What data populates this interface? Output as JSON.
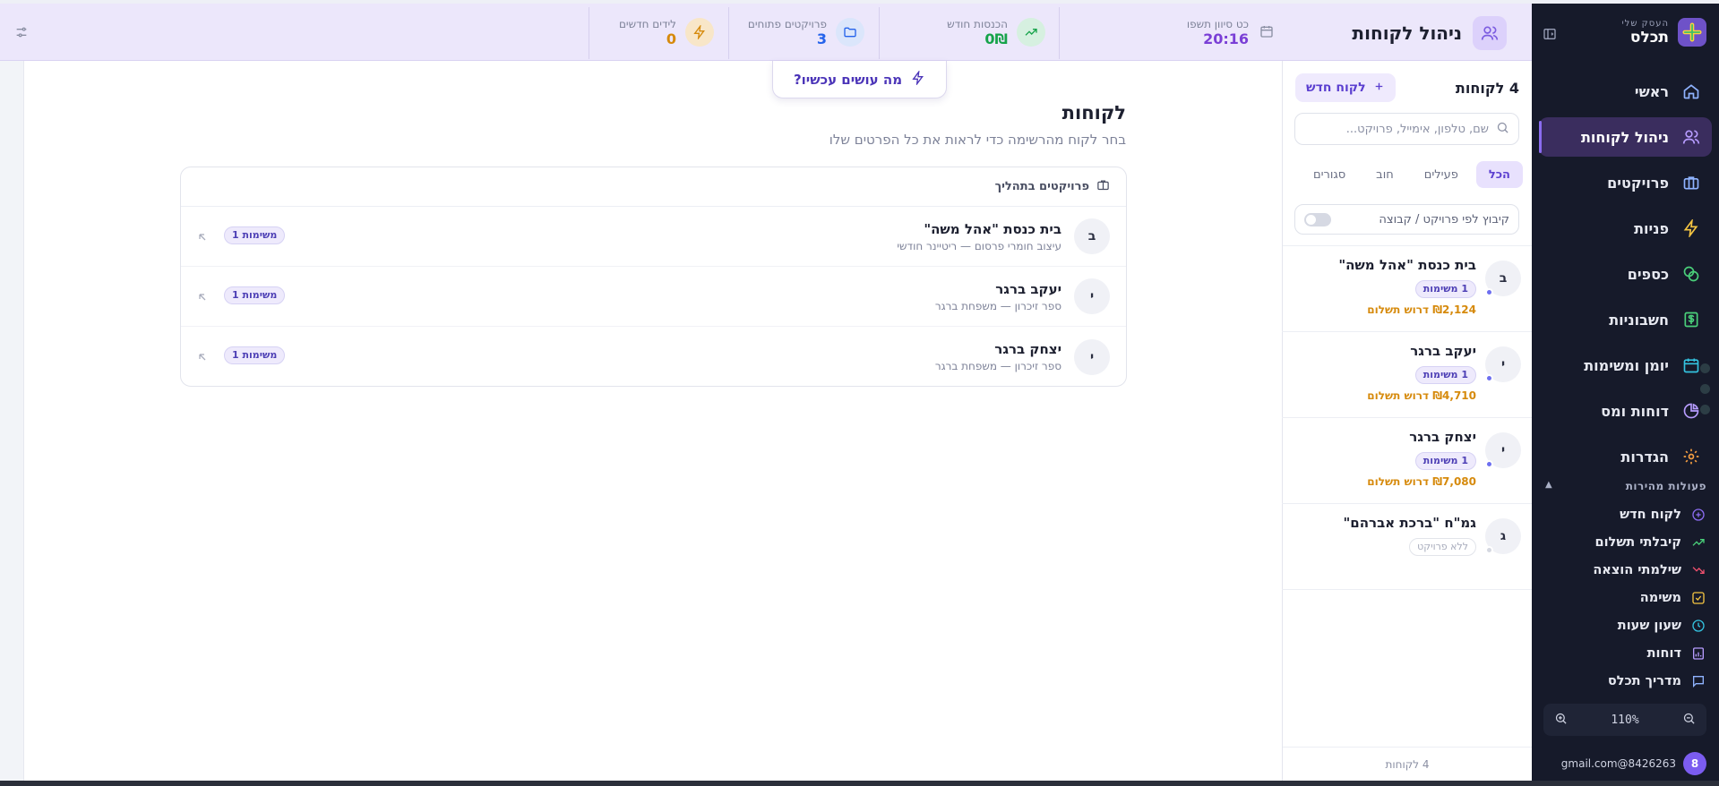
{
  "brand": {
    "subtitle": "העסק שלי",
    "name": "תכלס"
  },
  "header": {
    "title": "ניהול לקוחות",
    "stats": [
      {
        "label": "כט סיוון תשפו",
        "value": "20:16",
        "color": "#7a3fd6"
      },
      {
        "label": "הכנסות חודש",
        "value": "0₪",
        "color": "#16a34a"
      },
      {
        "label": "פרויקטים פתוחים",
        "value": "3",
        "color": "#2563eb"
      },
      {
        "label": "לידים חדשים",
        "value": "0",
        "color": "#d68a0c"
      }
    ]
  },
  "nav": [
    {
      "label": "ראשי",
      "icon": "home-icon"
    },
    {
      "label": "ניהול לקוחות",
      "icon": "users-icon",
      "active": true
    },
    {
      "label": "פרויקטים",
      "icon": "briefcase-icon"
    },
    {
      "label": "פניות",
      "icon": "lightning-icon"
    },
    {
      "label": "כספים",
      "icon": "coins-icon"
    },
    {
      "label": "חשבוניות",
      "icon": "dollar-doc-icon"
    },
    {
      "label": "יומן ומשימות",
      "icon": "calendar-icon"
    },
    {
      "label": "דוחות ומס",
      "icon": "pie-chart-icon"
    },
    {
      "label": "הגדרות",
      "icon": "gear-icon"
    }
  ],
  "quick": {
    "title": "פעולות מהירות",
    "items": [
      {
        "label": "לקוח חדש",
        "icon": "plus-circle-icon"
      },
      {
        "label": "קיבלתי תשלום",
        "icon": "trend-up-icon"
      },
      {
        "label": "שילמתי הוצאה",
        "icon": "trend-down-icon"
      },
      {
        "label": "משימה",
        "icon": "check-square-icon"
      },
      {
        "label": "שעון שעות",
        "icon": "clock-icon"
      },
      {
        "label": "דוחות",
        "icon": "report-icon"
      },
      {
        "label": "מדריך תכלס",
        "icon": "chat-icon"
      }
    ]
  },
  "zoom": {
    "value": "110%"
  },
  "user": {
    "email": "gmail.com@8426263",
    "initial": "8"
  },
  "panel": {
    "count_label": "4 לקוחות",
    "new_client": "לקוח חדש",
    "search_placeholder": "שם, טלפון, אימייל, פרויקט...",
    "tabs": [
      "הכל",
      "פעילים",
      "חוב",
      "סגורים"
    ],
    "group_label": "קיבוץ לפי פרויקט / קבוצה",
    "clients": [
      {
        "initial": "ב",
        "name": "בית כנסת \"אהל משה\"",
        "badge": "1 משימות",
        "debt": "₪2,124 דרוש תשלום"
      },
      {
        "initial": "י",
        "name": "יעקב ברגר",
        "badge": "1 משימות",
        "debt": "₪4,710 דרוש תשלום"
      },
      {
        "initial": "י",
        "name": "יצחק ברגר",
        "badge": "1 משימות",
        "debt": "₪7,080 דרוש תשלום"
      },
      {
        "initial": "ג",
        "name": "גמ\"ח \"ברכת אברהם\"",
        "badge": "ללא פרויקט",
        "debt": ""
      }
    ],
    "footer": "4 לקוחות"
  },
  "main": {
    "whats_now": "מה עושים עכשיו?",
    "title": "לקוחות",
    "subtitle": "בחר לקוח מהרשימה כדי לראות את כל הפרטים שלו",
    "card_title": "פרויקטים בתהליך",
    "rows": [
      {
        "initial": "ב",
        "name": "בית כנסת \"אהל משה\"",
        "desc": "עיצוב חומרי פרסום — ריטיינר חודשי",
        "badge": "1 משימות"
      },
      {
        "initial": "י",
        "name": "יעקב ברגר",
        "desc": "ספר זיכרון — משפחת ברגר",
        "badge": "1 משימות"
      },
      {
        "initial": "י",
        "name": "יצחק ברגר",
        "desc": "ספר זיכרון — משפחת ברגר",
        "badge": "1 משימות"
      }
    ]
  }
}
